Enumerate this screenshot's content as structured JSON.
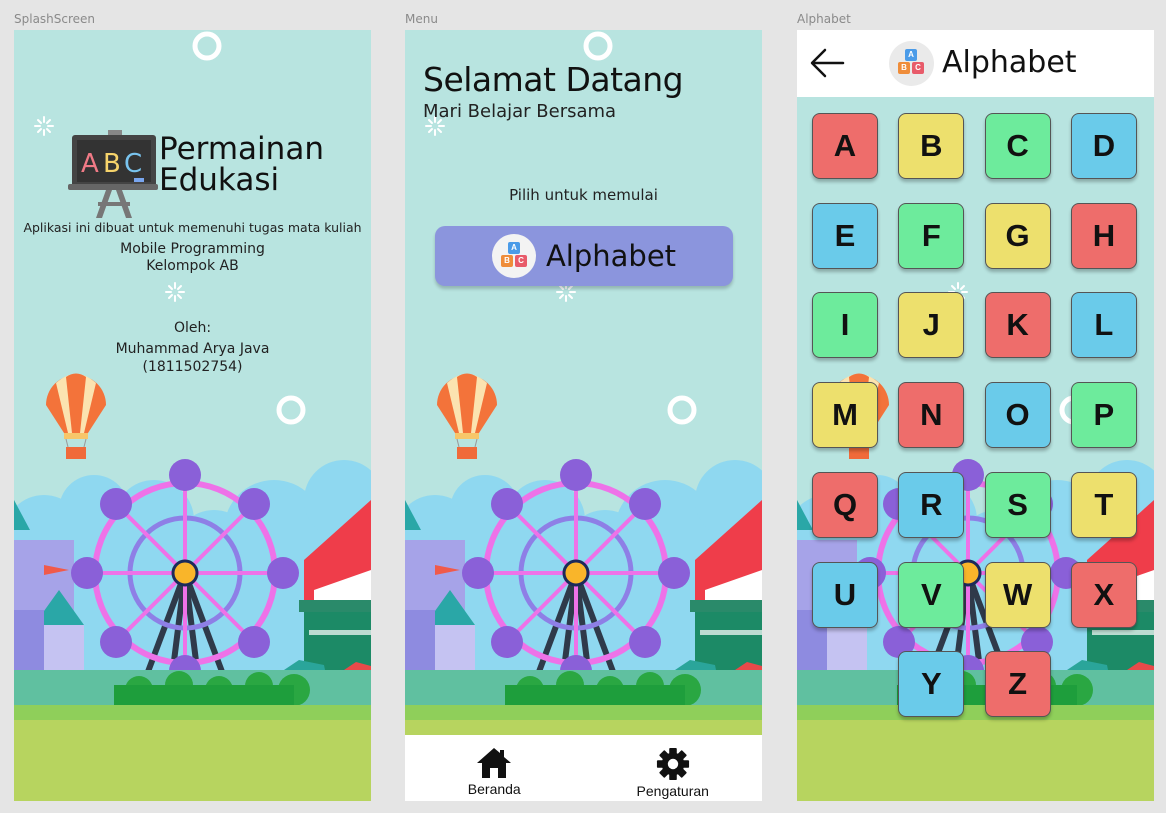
{
  "frames": {
    "splash_label": "SplashScreen",
    "menu_label": "Menu",
    "alphabet_label": "Alphabet"
  },
  "splash": {
    "board_text": "ABC",
    "title_line1": "Permainan",
    "title_line2": "Edukasi",
    "description": "Aplikasi ini dibuat untuk memenuhi tugas mata kuliah",
    "course": "Mobile Programming",
    "group": "Kelompok AB",
    "by_label": "Oleh:",
    "author": "Muhammad Arya Java",
    "author_id": "(1811502754)"
  },
  "menu": {
    "welcome": "Selamat Datang",
    "subtitle": "Mari Belajar Bersama",
    "prompt": "Pilih untuk memulai",
    "alphabet_button": "Alphabet",
    "nav": {
      "home_label": "Beranda",
      "settings_label": "Pengaturan"
    }
  },
  "alphabet": {
    "title": "Alphabet",
    "letters": [
      "A",
      "B",
      "C",
      "D",
      "E",
      "F",
      "G",
      "H",
      "I",
      "J",
      "K",
      "L",
      "M",
      "N",
      "O",
      "P",
      "Q",
      "R",
      "S",
      "T",
      "U",
      "V",
      "W",
      "X",
      "Y",
      "Z"
    ]
  },
  "icon_blocks": [
    "A",
    "B",
    "C"
  ],
  "colors": {
    "background": "#b8e4e0",
    "button": "#8b95dd",
    "red": "#ee6d6b",
    "yellow": "#ede06d",
    "green": "#6deb9c",
    "blue": "#6acbea"
  }
}
